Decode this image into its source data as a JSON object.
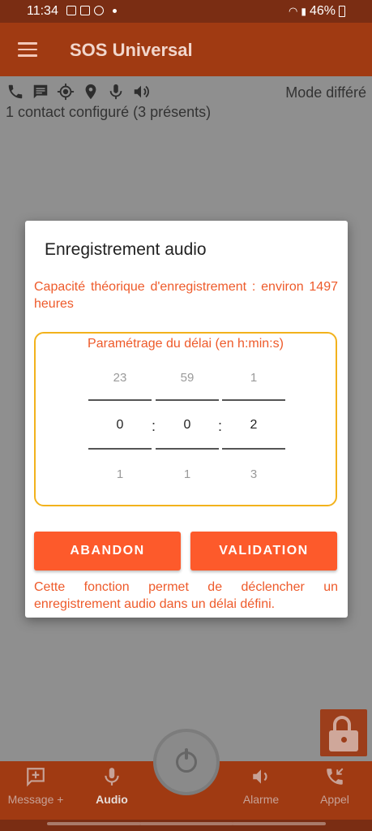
{
  "status_bar": {
    "time": "11:34",
    "battery_percent": "46%"
  },
  "app_bar": {
    "title": "SOS Universal"
  },
  "content": {
    "mode": "Mode différé",
    "contacts": "1 contact configuré (3 présents)",
    "status_icons": [
      "phone-icon",
      "message-icon",
      "gps-target-icon",
      "location-pin-icon",
      "microphone-icon",
      "speaker-icon"
    ]
  },
  "dialog": {
    "title": "Enregistrement audio",
    "capacity": "Capacité théorique d'enregistrement : environ 1497 heures",
    "timer_label": "Paramétrage du délai (en h:min:s)",
    "pickers": [
      {
        "above": "23",
        "current": "0",
        "below": "1"
      },
      {
        "above": "59",
        "current": "0",
        "below": "1"
      },
      {
        "above": "1",
        "current": "2",
        "below": "3"
      }
    ],
    "separator": ":",
    "cancel_label": "ABANDON",
    "validate_label": "VALIDATION",
    "description": "Cette fonction permet de déclencher un enregistrement audio dans un délai défini."
  },
  "bottom_nav": {
    "items": [
      {
        "label": "Message +",
        "icon": "add-message-icon"
      },
      {
        "label": "Audio",
        "icon": "microphone-icon",
        "active": true
      },
      {
        "label": "Alarme",
        "icon": "speaker-icon"
      },
      {
        "label": "Appel",
        "icon": "phone-call-icon"
      }
    ]
  },
  "colors": {
    "accent": "#fd5a2b",
    "appbar": "#a03a12",
    "timer_border": "#f2b21c",
    "text_accent": "#ee5a2a"
  }
}
